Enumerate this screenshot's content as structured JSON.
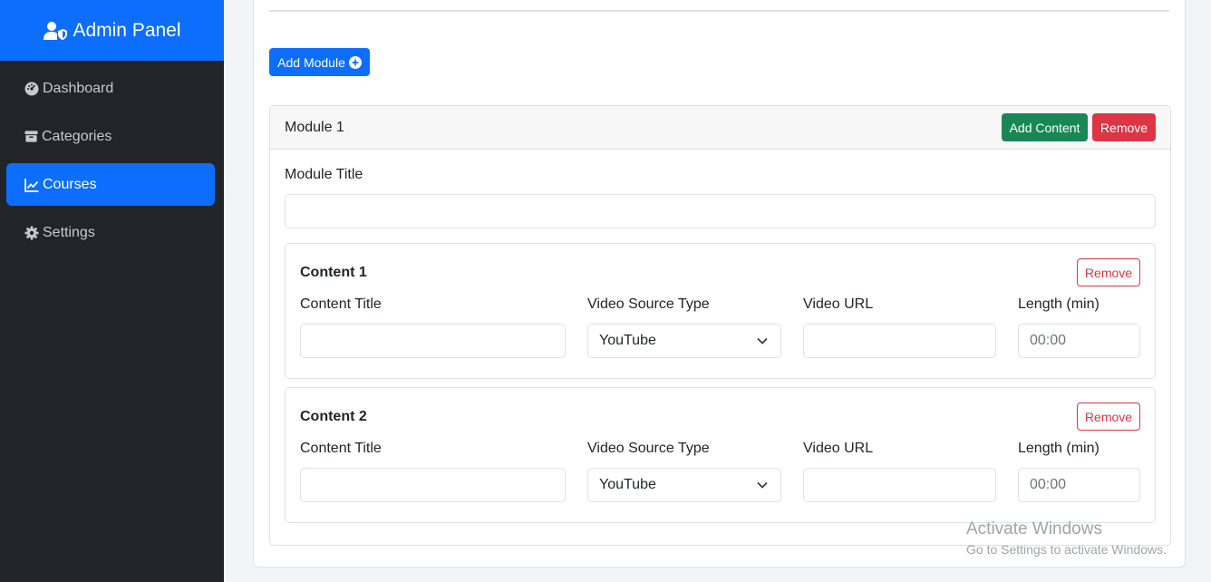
{
  "sidebar": {
    "brand": "Admin Panel",
    "items": [
      {
        "label": "Dashboard",
        "icon": "dashboard-icon"
      },
      {
        "label": "Categories",
        "icon": "box-icon"
      },
      {
        "label": "Courses",
        "icon": "chart-line-icon",
        "active": true
      },
      {
        "label": "Settings",
        "icon": "gear-icon"
      }
    ]
  },
  "main": {
    "add_module_label": "Add Module",
    "module": {
      "name": "Module 1",
      "add_content_label": "Add Content",
      "remove_label": "Remove",
      "title_label": "Module Title",
      "title_value": "",
      "contents": [
        {
          "name": "Content 1",
          "remove_label": "Remove",
          "title_label": "Content Title",
          "title_value": "",
          "source_label": "Video Source Type",
          "source_value": "YouTube",
          "url_label": "Video URL",
          "url_value": "",
          "length_label": "Length (min)",
          "length_placeholder": "00:00"
        },
        {
          "name": "Content 2",
          "remove_label": "Remove",
          "title_label": "Content Title",
          "title_value": "",
          "source_label": "Video Source Type",
          "source_value": "YouTube",
          "url_label": "Video URL",
          "url_value": "",
          "length_label": "Length (min)",
          "length_placeholder": "00:00"
        }
      ]
    }
  },
  "watermark": {
    "title": "Activate Windows",
    "subtitle": "Go to Settings to activate Windows."
  },
  "colors": {
    "primary": "#0d6efd",
    "success": "#198754",
    "danger": "#dc3545",
    "sidebar_bg": "#212529"
  }
}
